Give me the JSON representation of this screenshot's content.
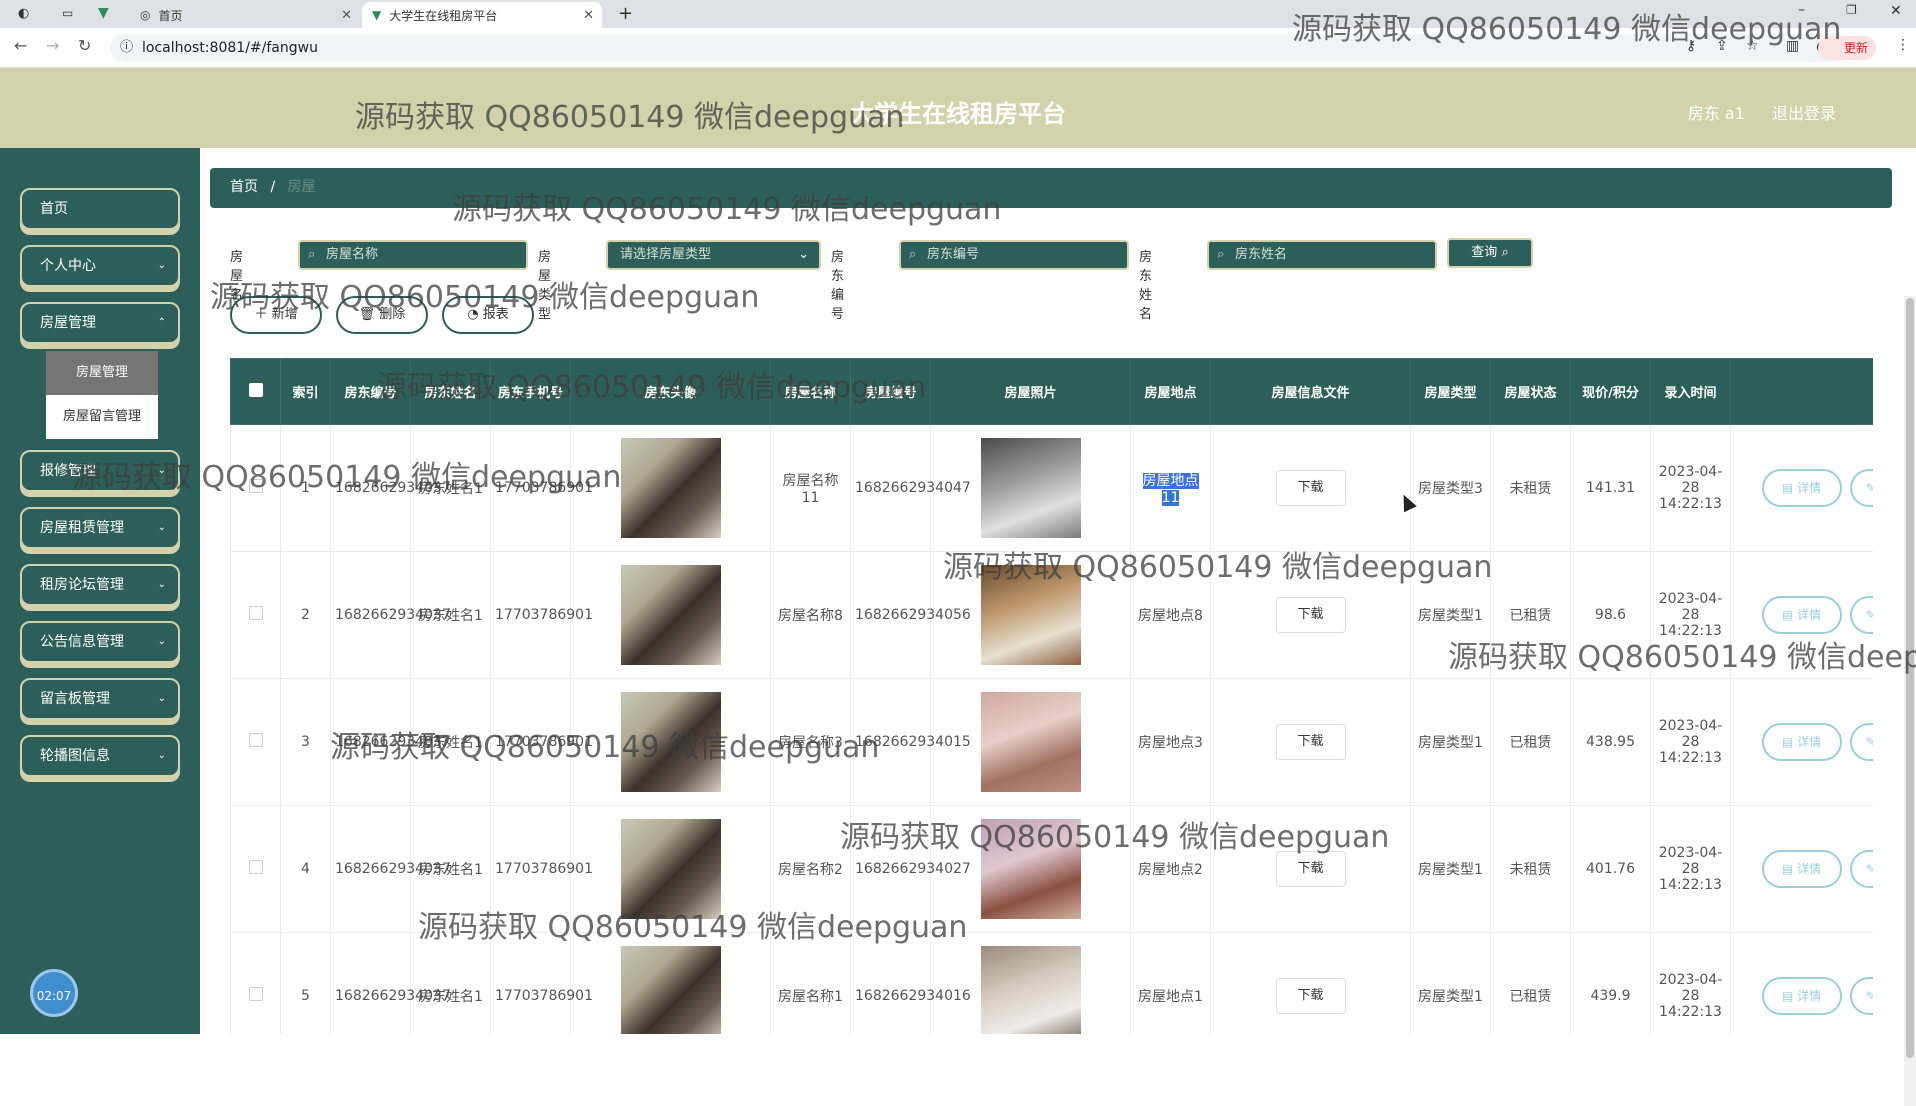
{
  "browser": {
    "tabs": [
      {
        "label": "首页"
      },
      {
        "label": "大学生在线租房平台"
      }
    ],
    "url": "localhost:8081/#/fangwu",
    "update_label": "更新"
  },
  "header": {
    "title": "大学生在线租房平台",
    "user": "房东 a1",
    "logout": "退出登录"
  },
  "sidebar": {
    "items": [
      {
        "label": "首页"
      },
      {
        "label": "个人中心"
      },
      {
        "label": "房屋管理"
      },
      {
        "label": "报修管理"
      },
      {
        "label": "房屋租赁管理"
      },
      {
        "label": "租房论坛管理"
      },
      {
        "label": "公告信息管理"
      },
      {
        "label": "留言板管理"
      },
      {
        "label": "轮播图信息"
      }
    ],
    "submenu": [
      {
        "label": "房屋管理"
      },
      {
        "label": "房屋留言管理"
      }
    ],
    "clock": "02:07"
  },
  "breadcrumb": {
    "home": "首页",
    "sep": "/",
    "current": "房屋"
  },
  "search": {
    "name_label": "房屋名称",
    "name_placeholder": "房屋名称",
    "type_label": "房屋类型",
    "type_placeholder": "请选择房屋类型",
    "landlord_no_label": "房东编号",
    "landlord_no_placeholder": "房东编号",
    "landlord_name_label": "房东姓名",
    "landlord_name_placeholder": "房东姓名",
    "query_label": "查询"
  },
  "actions": {
    "add": "新增",
    "delete": "删除",
    "report": "报表"
  },
  "table": {
    "headers": [
      "索引",
      "房东编号",
      "房东姓名",
      "房东手机号",
      "房东头像",
      "房屋名称",
      "房屋编号",
      "房屋照片",
      "房屋地点",
      "房屋信息文件",
      "房屋类型",
      "房屋状态",
      "现价/积分",
      "录入时间"
    ],
    "download_label": "下载",
    "detail_label": "详情",
    "rows": [
      {
        "index": "1",
        "landlord_no": "1682662934037",
        "landlord_name": "房东姓名1",
        "phone": "17703786901",
        "house_name": "房屋名称11",
        "house_no": "1682662934047",
        "location": "房屋地点11",
        "type": "房屋类型3",
        "status": "未租赁",
        "price": "141.31",
        "time": "2023-04-28 14:22:13"
      },
      {
        "index": "2",
        "landlord_no": "1682662934037",
        "landlord_name": "房东姓名1",
        "phone": "17703786901",
        "house_name": "房屋名称8",
        "house_no": "1682662934056",
        "location": "房屋地点8",
        "type": "房屋类型1",
        "status": "已租赁",
        "price": "98.6",
        "time": "2023-04-28 14:22:13"
      },
      {
        "index": "3",
        "landlord_no": "1682662934037",
        "landlord_name": "房东姓名1",
        "phone": "17703786901",
        "house_name": "房屋名称3",
        "house_no": "1682662934015",
        "location": "房屋地点3",
        "type": "房屋类型1",
        "status": "已租赁",
        "price": "438.95",
        "time": "2023-04-28 14:22:13"
      },
      {
        "index": "4",
        "landlord_no": "1682662934037",
        "landlord_name": "房东姓名1",
        "phone": "17703786901",
        "house_name": "房屋名称2",
        "house_no": "1682662934027",
        "location": "房屋地点2",
        "type": "房屋类型1",
        "status": "未租赁",
        "price": "401.76",
        "time": "2023-04-28 14:22:13"
      },
      {
        "index": "5",
        "landlord_no": "1682662934037",
        "landlord_name": "房东姓名1",
        "phone": "17703786901",
        "house_name": "房屋名称1",
        "house_no": "1682662934016",
        "location": "房屋地点1",
        "type": "房屋类型1",
        "status": "已租赁",
        "price": "439.9",
        "time": "2023-04-28 14:22:13"
      }
    ]
  },
  "watermark": "源码获取 QQ86050149 微信deepguan"
}
